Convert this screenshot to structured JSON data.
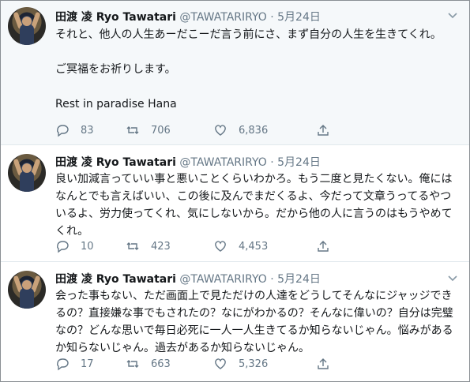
{
  "tweets": [
    {
      "name": "田渡 凌 Ryo Tawatari",
      "handle": "@TAWATARIRYO",
      "sep": "·",
      "date": "5月24日",
      "text": "それと、他人の人生あーだこーだ言う前にさ、まず自分の人生を生きてくれ。\n\nご冥福をお祈りします。\n\nRest in paradise Hana",
      "replies": "83",
      "retweets": "706",
      "likes": "6,836"
    },
    {
      "name": "田渡 凌 Ryo Tawatari",
      "handle": "@TAWATARIRYO",
      "sep": "·",
      "date": "5月24日",
      "text": "良い加減言っていい事と悪いことくらいわかろ。もう二度と見たくない。俺にはなんとでも言えばいい、この後に及んでまだくるよ、今だって文章うってるやついるよ、労力使ってくれ、気にしないから。だから他の人に言うのはもうやめてくれ。",
      "replies": "10",
      "retweets": "423",
      "likes": "4,453"
    },
    {
      "name": "田渡 凌 Ryo Tawatari",
      "handle": "@TAWATARIRYO",
      "sep": "·",
      "date": "5月24日",
      "text": "会った事もない、ただ画面上で見ただけの人達をどうしてそんなにジャッジできるの？直接嫌な事でもされたの？なにがわかるの？そんなに偉いの？自分は完璧なの？どんな思いで毎日必死に一人一人生きてるか知らないじゃん。悩みがあるか知らないじゃん。過去があるか知らないじゃん。",
      "replies": "17",
      "retweets": "663",
      "likes": "5,326"
    }
  ],
  "icons": {
    "reply": "reply-icon",
    "retweet": "retweet-icon",
    "like": "heart-icon",
    "share": "share-icon",
    "caret": "chevron-down-icon"
  },
  "colors": {
    "text": "#14171a",
    "muted": "#657786",
    "highlight_bg": "#f5f8fa",
    "divider": "#e1e8ed"
  }
}
